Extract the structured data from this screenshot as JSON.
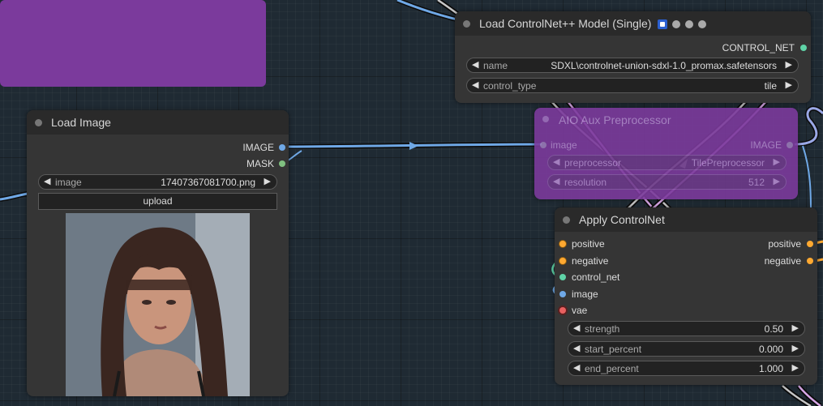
{
  "canvas": {
    "background": "#1f2a33"
  },
  "load_controlnet": {
    "title": "Load ControlNet++ Model (Single)",
    "badges": [
      "puzzle-badge-icon",
      "a-badge",
      "c-badge",
      "n-badge"
    ],
    "output": "CONTROL_NET",
    "widgets": [
      {
        "label": "name",
        "value": "SDXL\\controlnet-union-sdxl-1.0_promax.safetensors"
      },
      {
        "label": "control_type",
        "value": "tile"
      }
    ]
  },
  "aux_preprocessor": {
    "title": "AIO Aux Preprocessor",
    "input": "image",
    "output": "IMAGE",
    "widgets": [
      {
        "label": "preprocessor",
        "value": "TilePreprocessor"
      },
      {
        "label": "resolution",
        "value": "512"
      }
    ],
    "color": "#7b3a9c"
  },
  "load_image": {
    "title": "Load Image",
    "outputs": [
      "IMAGE",
      "MASK"
    ],
    "widgets": [
      {
        "label": "image",
        "value": "17407367081700.png"
      }
    ],
    "upload_label": "upload",
    "preview_alt": "portrait photo"
  },
  "apply_controlnet": {
    "title": "Apply ControlNet",
    "inputs": [
      "positive",
      "negative",
      "control_net",
      "image",
      "vae"
    ],
    "outputs": [
      "positive",
      "negative"
    ],
    "widgets": [
      {
        "label": "strength",
        "value": "0.50"
      },
      {
        "label": "start_percent",
        "value": "0.000"
      },
      {
        "label": "end_percent",
        "value": "1.000"
      }
    ]
  },
  "colors": {
    "image_socket": "#6fa8e6",
    "mask_socket": "#80c080",
    "controlnet_socket": "#5fd3a7",
    "conditioning_socket": "#ffa931",
    "vae_socket": "#e86060",
    "group": "#7b3a9c"
  }
}
